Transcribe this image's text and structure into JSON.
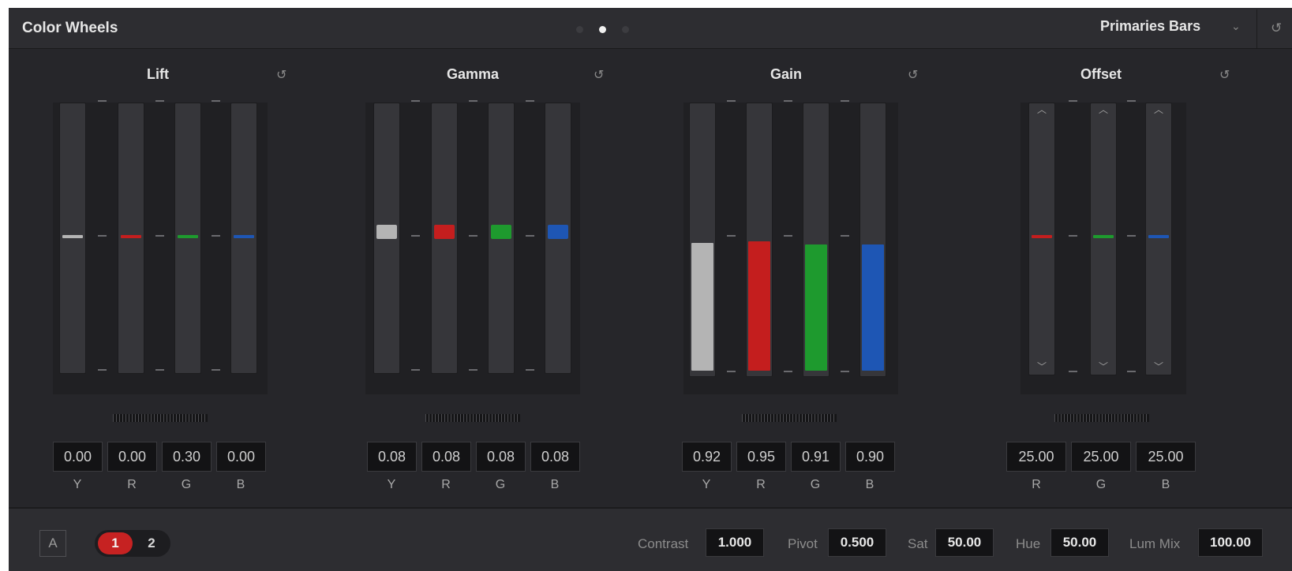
{
  "header": {
    "title": "Color Wheels",
    "mode": "Primaries Bars",
    "mode_caret": "⌄",
    "reset_glyph": "↺",
    "page_dots": 3,
    "active_dot": 2
  },
  "colors": {
    "y": "#b4b4b4",
    "r": "#c41e1e",
    "g": "#1e9a2e",
    "b": "#1e56b4"
  },
  "groups": [
    {
      "title": "Lift",
      "channels": [
        "Y",
        "R",
        "G",
        "B"
      ],
      "values": [
        "0.00",
        "0.00",
        "0.30",
        "0.00"
      ]
    },
    {
      "title": "Gamma",
      "channels": [
        "Y",
        "R",
        "G",
        "B"
      ],
      "values": [
        "0.08",
        "0.08",
        "0.08",
        "0.08"
      ]
    },
    {
      "title": "Gain",
      "channels": [
        "Y",
        "R",
        "G",
        "B"
      ],
      "values": [
        "0.92",
        "0.95",
        "0.91",
        "0.90"
      ]
    },
    {
      "title": "Offset",
      "channels": [
        "R",
        "G",
        "B"
      ],
      "values": [
        "25.00",
        "25.00",
        "25.00"
      ]
    }
  ],
  "footer": {
    "a_button": "A",
    "pages": [
      "1",
      "2"
    ],
    "active_page": "1",
    "contrast_label": "Contrast",
    "contrast": "1.000",
    "pivot_label": "Pivot",
    "pivot": "0.500",
    "sat_label": "Sat",
    "sat": "50.00",
    "hue_label": "Hue",
    "hue": "50.00",
    "lummix_label": "Lum Mix",
    "lummix": "100.00"
  }
}
